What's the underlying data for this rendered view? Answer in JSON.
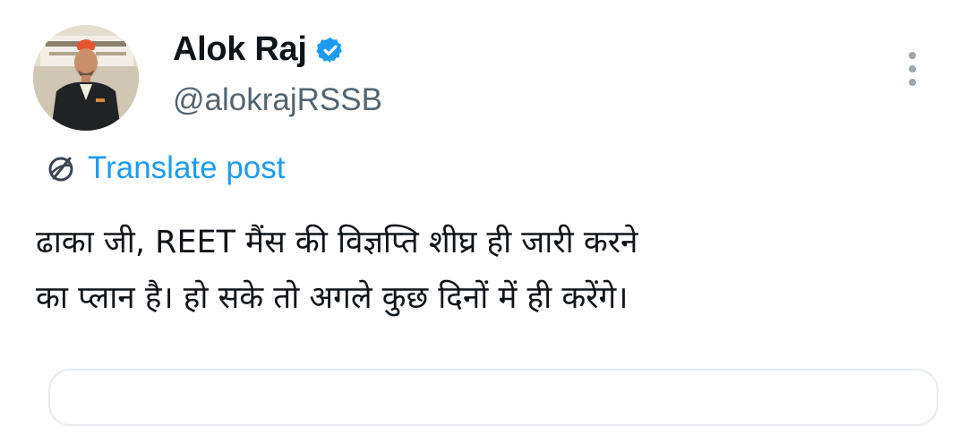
{
  "tweet_header": {
    "display_name": "Alok Raj",
    "handle": "@alokrajRSSB",
    "verified_icon": "verified-badge-icon",
    "more_icon": "more-vertical-icon"
  },
  "translate": {
    "label": "Translate post",
    "icon": "translate-globe-icon"
  },
  "tweet_text": {
    "line1": "ढाका जी, REET मैंस की विज्ञप्ति शीघ्र ही जारी करने",
    "line2": "का प्लान है। हो सके तो अगले कुछ दिनों में ही करेंगे।"
  },
  "colors": {
    "accent": "#1d9bf0",
    "handle_gray": "#536471",
    "text": "#0f1419"
  }
}
